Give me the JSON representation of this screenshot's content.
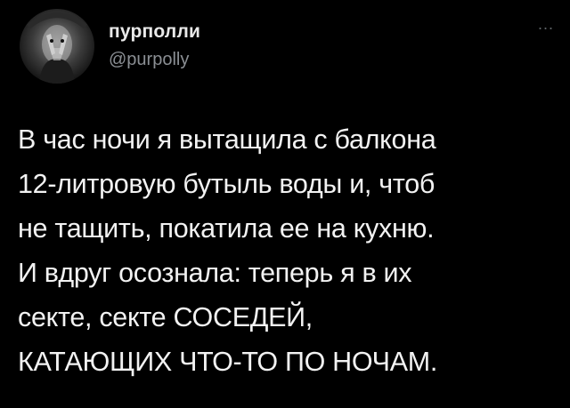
{
  "author": {
    "display_name": "пурполли",
    "handle": "@purpolly",
    "avatar_icon": "user-avatar"
  },
  "menu": {
    "more_label": "..."
  },
  "tweet": {
    "text": "В час ночи я вытащила с балкона\n12-литровую бутыль воды и, чтоб\nне тащить, покатила ее на кухню.\nИ вдруг осознала: теперь я в их\nсекте, секте СОСЕДЕЙ,\nКАТАЮЩИХ ЧТО-ТО ПО НОЧАМ."
  },
  "colors": {
    "background": "#000000",
    "text": "#f2f2f2",
    "handle": "#8b8f94"
  }
}
